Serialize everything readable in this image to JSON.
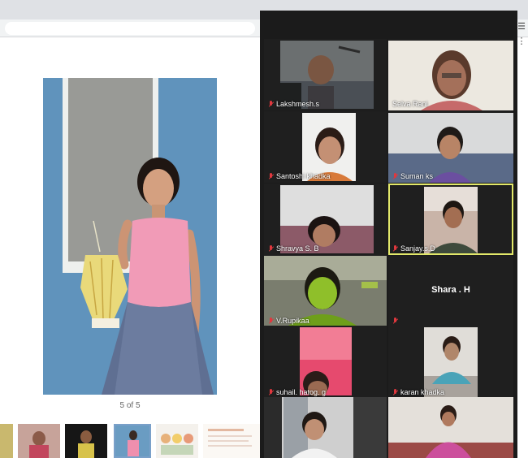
{
  "viewer": {
    "counter": "5 of 5"
  },
  "gallery": {
    "participants": [
      {
        "name": "Lakshmesh.s",
        "muted": true
      },
      {
        "name": "Selva Rani",
        "muted": false
      },
      {
        "name": "Santoshi khadka",
        "muted": true
      },
      {
        "name": "Suman ks",
        "muted": true
      },
      {
        "name": "Shravya S. B",
        "muted": true
      },
      {
        "name": "Sanjay.s.D",
        "muted": true,
        "active_speaker": true
      },
      {
        "name": "V.Rupikaa",
        "muted": true
      },
      {
        "name": "Shara . H",
        "muted": true,
        "video_off": true
      },
      {
        "name": "suhail.     hatog.     g",
        "muted": true
      },
      {
        "name": "karan khadka",
        "muted": true
      },
      {
        "name": "",
        "muted": false
      },
      {
        "name": "",
        "muted": false
      }
    ]
  },
  "colors": {
    "gallery_bg": "#1b1b1b",
    "active_speaker_border": "#e2e86a",
    "muted_icon": "#e0383e"
  }
}
